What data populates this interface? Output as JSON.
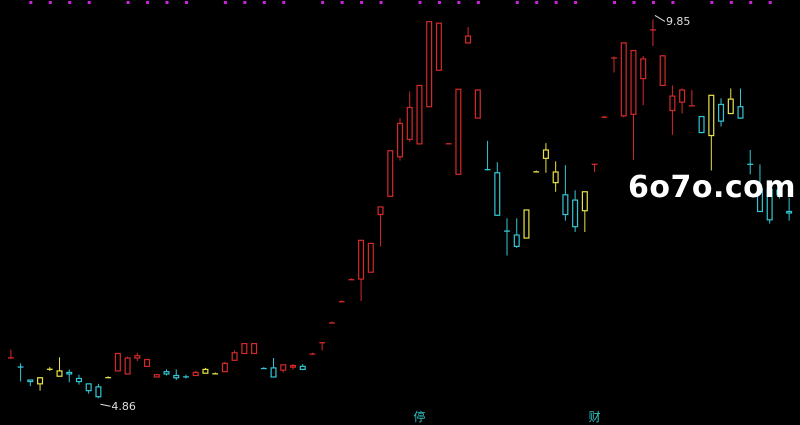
{
  "chart_data": {
    "type": "candlestick",
    "price_range": [
      4.6,
      10.0
    ],
    "colors": {
      "up": "#d42a2a",
      "down": "#33c7d6",
      "neutral": "#e8e34a",
      "top_dots": "#d020e0",
      "marker": "#2ec4c4",
      "background": "#000000"
    },
    "candles": [
      {
        "o": 5.4,
        "h": 5.5,
        "l": 5.38,
        "c": 5.4,
        "color": "up"
      },
      {
        "o": 5.28,
        "h": 5.32,
        "l": 5.08,
        "c": 5.28,
        "color": "down"
      },
      {
        "o": 5.1,
        "h": 5.1,
        "l": 5.02,
        "c": 5.08,
        "color": "down"
      },
      {
        "o": 5.05,
        "h": 5.14,
        "l": 4.96,
        "c": 5.13,
        "color": "neutral"
      },
      {
        "o": 5.25,
        "h": 5.27,
        "l": 5.22,
        "c": 5.25,
        "color": "neutral"
      },
      {
        "o": 5.15,
        "h": 5.4,
        "l": 5.15,
        "c": 5.22,
        "color": "neutral"
      },
      {
        "o": 5.18,
        "h": 5.24,
        "l": 5.07,
        "c": 5.2,
        "color": "down"
      },
      {
        "o": 5.12,
        "h": 5.17,
        "l": 5.04,
        "c": 5.08,
        "color": "down"
      },
      {
        "o": 5.05,
        "h": 5.05,
        "l": 4.92,
        "c": 4.96,
        "color": "down"
      },
      {
        "o": 5.01,
        "h": 5.05,
        "l": 4.86,
        "c": 4.88,
        "color": "down"
      },
      {
        "o": 5.14,
        "h": 5.15,
        "l": 5.14,
        "c": 5.14,
        "color": "neutral"
      },
      {
        "o": 5.22,
        "h": 5.45,
        "l": 5.22,
        "c": 5.45,
        "color": "up"
      },
      {
        "o": 5.18,
        "h": 5.41,
        "l": 5.18,
        "c": 5.39,
        "color": "up"
      },
      {
        "o": 5.39,
        "h": 5.46,
        "l": 5.35,
        "c": 5.42,
        "color": "up"
      },
      {
        "o": 5.28,
        "h": 5.37,
        "l": 5.28,
        "c": 5.37,
        "color": "up"
      },
      {
        "o": 5.17,
        "h": 5.18,
        "l": 5.14,
        "c": 5.14,
        "color": "up"
      },
      {
        "o": 5.18,
        "h": 5.24,
        "l": 5.16,
        "c": 5.21,
        "color": "down"
      },
      {
        "o": 5.16,
        "h": 5.24,
        "l": 5.1,
        "c": 5.13,
        "color": "down"
      },
      {
        "o": 5.14,
        "h": 5.17,
        "l": 5.12,
        "c": 5.15,
        "color": "down"
      },
      {
        "o": 5.16,
        "h": 5.22,
        "l": 5.16,
        "c": 5.2,
        "color": "up"
      },
      {
        "o": 5.19,
        "h": 5.26,
        "l": 5.19,
        "c": 5.24,
        "color": "neutral"
      },
      {
        "o": 5.18,
        "h": 5.2,
        "l": 5.18,
        "c": 5.19,
        "color": "neutral"
      },
      {
        "o": 5.21,
        "h": 5.34,
        "l": 5.21,
        "c": 5.32,
        "color": "up"
      },
      {
        "o": 5.36,
        "h": 5.49,
        "l": 5.36,
        "c": 5.46,
        "color": "up"
      },
      {
        "o": 5.45,
        "h": 5.58,
        "l": 5.45,
        "c": 5.58,
        "color": "up"
      },
      {
        "o": 5.45,
        "h": 5.58,
        "l": 5.45,
        "c": 5.58,
        "color": "up"
      },
      {
        "o": 5.26,
        "h": 5.27,
        "l": 5.25,
        "c": 5.26,
        "color": "down"
      },
      {
        "o": 5.26,
        "h": 5.39,
        "l": 5.14,
        "c": 5.14,
        "color": "down"
      },
      {
        "o": 5.23,
        "h": 5.3,
        "l": 5.2,
        "c": 5.3,
        "color": "up"
      },
      {
        "o": 5.27,
        "h": 5.31,
        "l": 5.24,
        "c": 5.29,
        "color": "up"
      },
      {
        "o": 5.24,
        "h": 5.31,
        "l": 5.23,
        "c": 5.28,
        "color": "down"
      },
      {
        "o": 5.45,
        "h": 5.46,
        "l": 5.44,
        "c": 5.45,
        "color": "up"
      },
      {
        "o": 5.6,
        "h": 5.6,
        "l": 5.49,
        "c": 5.6,
        "color": "up"
      },
      {
        "o": 5.86,
        "h": 5.87,
        "l": 5.85,
        "c": 5.86,
        "color": "up"
      },
      {
        "o": 6.14,
        "h": 6.15,
        "l": 6.13,
        "c": 6.14,
        "color": "up"
      },
      {
        "o": 6.43,
        "h": 6.44,
        "l": 6.42,
        "c": 6.43,
        "color": "up"
      },
      {
        "o": 6.43,
        "h": 6.94,
        "l": 6.14,
        "c": 6.94,
        "color": "up"
      },
      {
        "o": 6.52,
        "h": 6.9,
        "l": 6.52,
        "c": 6.9,
        "color": "up"
      },
      {
        "o": 7.28,
        "h": 7.38,
        "l": 6.86,
        "c": 7.38,
        "color": "up"
      },
      {
        "o": 7.52,
        "h": 8.12,
        "l": 7.52,
        "c": 8.12,
        "color": "up"
      },
      {
        "o": 8.04,
        "h": 8.55,
        "l": 7.99,
        "c": 8.48,
        "color": "up"
      },
      {
        "o": 8.27,
        "h": 8.9,
        "l": 8.24,
        "c": 8.69,
        "color": "up"
      },
      {
        "o": 8.21,
        "h": 8.98,
        "l": 8.21,
        "c": 8.98,
        "color": "up"
      },
      {
        "o": 8.7,
        "h": 9.82,
        "l": 8.7,
        "c": 9.82,
        "color": "up"
      },
      {
        "o": 9.18,
        "h": 9.8,
        "l": 9.18,
        "c": 9.8,
        "color": "up"
      },
      {
        "o": 8.22,
        "h": 8.22,
        "l": 8.22,
        "c": 8.22,
        "color": "up"
      },
      {
        "o": 7.81,
        "h": 8.93,
        "l": 7.81,
        "c": 8.93,
        "color": "up"
      },
      {
        "o": 9.54,
        "h": 9.75,
        "l": 9.54,
        "c": 9.63,
        "color": "up"
      },
      {
        "o": 8.55,
        "h": 8.93,
        "l": 8.55,
        "c": 8.92,
        "color": "up"
      },
      {
        "o": 7.88,
        "h": 8.25,
        "l": 7.86,
        "c": 7.87,
        "color": "down"
      },
      {
        "o": 7.83,
        "h": 7.97,
        "l": 7.26,
        "c": 7.27,
        "color": "down"
      },
      {
        "o": 7.07,
        "h": 7.23,
        "l": 6.74,
        "c": 7.07,
        "color": "down"
      },
      {
        "o": 7.01,
        "h": 7.23,
        "l": 6.84,
        "c": 6.86,
        "color": "down"
      },
      {
        "o": 6.97,
        "h": 7.34,
        "l": 6.97,
        "c": 7.34,
        "color": "neutral"
      },
      {
        "o": 7.85,
        "h": 7.86,
        "l": 7.84,
        "c": 7.85,
        "color": "neutral"
      },
      {
        "o": 8.13,
        "h": 8.22,
        "l": 7.83,
        "c": 8.02,
        "color": "neutral"
      },
      {
        "o": 7.84,
        "h": 7.98,
        "l": 7.58,
        "c": 7.7,
        "color": "neutral"
      },
      {
        "o": 7.54,
        "h": 7.93,
        "l": 7.2,
        "c": 7.28,
        "color": "down"
      },
      {
        "o": 7.47,
        "h": 7.6,
        "l": 7.05,
        "c": 7.12,
        "color": "down"
      },
      {
        "o": 7.58,
        "h": 7.58,
        "l": 7.05,
        "c": 7.33,
        "color": "neutral"
      },
      {
        "o": 7.95,
        "h": 7.95,
        "l": 7.84,
        "c": 7.95,
        "color": "up"
      },
      {
        "o": 8.57,
        "h": 8.58,
        "l": 8.56,
        "c": 8.57,
        "color": "up"
      },
      {
        "o": 9.35,
        "h": 9.36,
        "l": 9.15,
        "c": 9.35,
        "color": "up"
      },
      {
        "o": 8.58,
        "h": 9.54,
        "l": 8.56,
        "c": 9.54,
        "color": "up"
      },
      {
        "o": 8.6,
        "h": 9.44,
        "l": 8.0,
        "c": 9.44,
        "color": "up"
      },
      {
        "o": 9.07,
        "h": 9.37,
        "l": 8.72,
        "c": 9.33,
        "color": "up"
      },
      {
        "o": 9.72,
        "h": 9.85,
        "l": 9.5,
        "c": 9.72,
        "color": "up"
      },
      {
        "o": 8.98,
        "h": 9.38,
        "l": 8.98,
        "c": 9.37,
        "color": "up"
      },
      {
        "o": 8.65,
        "h": 8.98,
        "l": 8.33,
        "c": 8.84,
        "color": "up"
      },
      {
        "o": 8.76,
        "h": 8.94,
        "l": 8.61,
        "c": 8.92,
        "color": "up"
      },
      {
        "o": 8.72,
        "h": 8.92,
        "l": 8.72,
        "c": 8.72,
        "color": "up"
      },
      {
        "o": 8.57,
        "h": 8.57,
        "l": 8.35,
        "c": 8.36,
        "color": "down"
      },
      {
        "o": 8.32,
        "h": 8.84,
        "l": 7.86,
        "c": 8.85,
        "color": "neutral"
      },
      {
        "o": 8.73,
        "h": 8.81,
        "l": 8.44,
        "c": 8.51,
        "color": "down"
      },
      {
        "o": 8.61,
        "h": 8.94,
        "l": 8.61,
        "c": 8.8,
        "color": "neutral"
      },
      {
        "o": 8.7,
        "h": 8.94,
        "l": 8.54,
        "c": 8.55,
        "color": "down"
      },
      {
        "o": 7.94,
        "h": 8.13,
        "l": 7.81,
        "c": 7.95,
        "color": "down"
      },
      {
        "o": 7.62,
        "h": 7.94,
        "l": 7.32,
        "c": 7.32,
        "color": "down"
      },
      {
        "o": 7.61,
        "h": 7.61,
        "l": 7.16,
        "c": 7.21,
        "color": "down"
      },
      {
        "o": 7.6,
        "h": 7.69,
        "l": 7.49,
        "c": 7.54,
        "color": "down"
      },
      {
        "o": 7.3,
        "h": 7.5,
        "l": 7.2,
        "c": 7.32,
        "color": "down"
      }
    ],
    "annotations": [
      {
        "text": "4.86",
        "candle": 9,
        "price": 4.86,
        "side": "below"
      },
      {
        "text": "9.85",
        "candle": 66,
        "price": 9.85,
        "side": "above"
      }
    ],
    "markers": [
      {
        "text": "停",
        "candle": 42
      },
      {
        "text": "财",
        "candle": 60
      }
    ]
  },
  "watermark": "6o7o.com"
}
